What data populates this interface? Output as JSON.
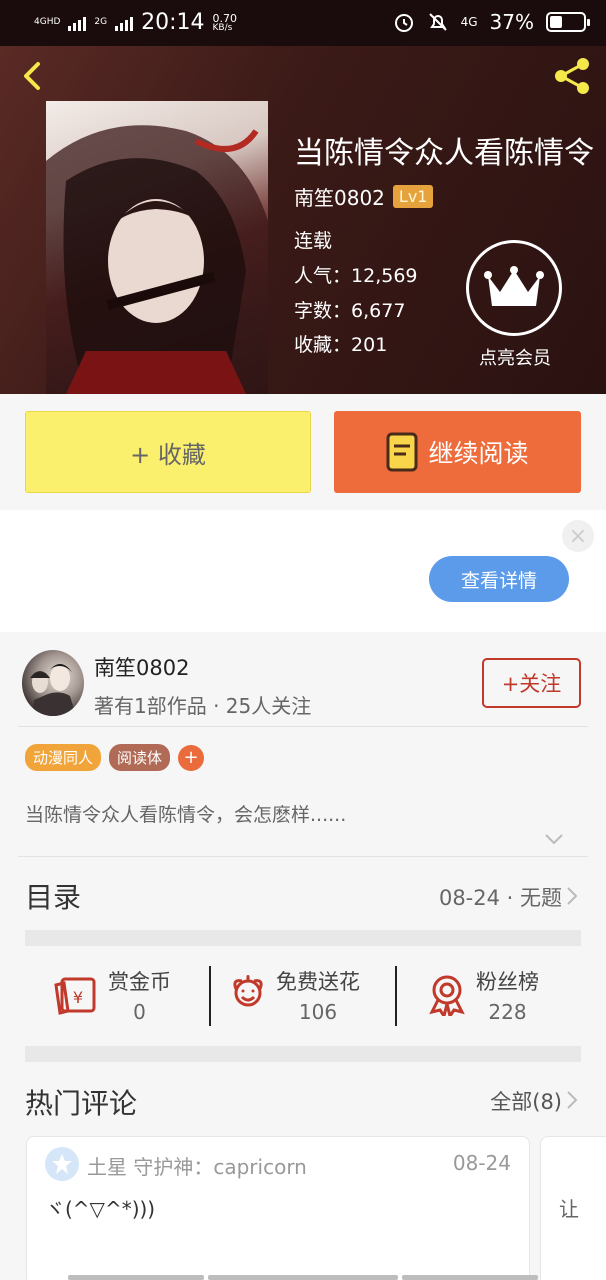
{
  "status_bar": {
    "network_1": "4GHD",
    "network_2": "2G",
    "time": "20:14",
    "speed_value": "0.70",
    "speed_unit": "KB/s",
    "net_type": "4G",
    "battery": "37%"
  },
  "book": {
    "title": "当陈情令众人看陈情令",
    "author": "南笙0802",
    "level": "Lv1",
    "status": "连载",
    "popularity_label": "人气：",
    "popularity": "12,569",
    "words_label": "字数：",
    "words": "6,677",
    "favorites_label": "收藏：",
    "favorites": "201",
    "vip_label": "点亮会员"
  },
  "actions": {
    "favorite": "+ 收藏",
    "continue_reading": "继续阅读"
  },
  "ad": {
    "close": "×",
    "details": "查看详情"
  },
  "author_card": {
    "name": "南笙0802",
    "sub": "著有1部作品 · 25人关注",
    "follow": "+关注"
  },
  "tags": [
    {
      "label": "动漫同人",
      "color": "#f0a43a"
    },
    {
      "label": "阅读体",
      "color": "#b06a55"
    }
  ],
  "tag_add": "+",
  "description": "当陈情令众人看陈情令，会怎麽样......",
  "toc": {
    "title": "目录",
    "latest": "08-24 · 无题"
  },
  "stats": [
    {
      "label": "赏金币",
      "value": "0",
      "icon": "reward-coin-icon"
    },
    {
      "label": "免费送花",
      "value": "106",
      "icon": "flower-icon"
    },
    {
      "label": "粉丝榜",
      "value": "228",
      "icon": "medal-icon"
    }
  ],
  "hot_comments": {
    "title": "热门评论",
    "all": "全部(8)"
  },
  "comments": [
    {
      "user": "土星 守护神：capricorn",
      "date": "08-24",
      "text": "ヾ(^▽^*)))"
    },
    {
      "text": "让"
    }
  ],
  "colors": {
    "accent_orange": "#ee6b3b",
    "favorite_yellow": "#fbf06e",
    "follow_red": "#c0392b",
    "ad_blue": "#5b9bea"
  }
}
